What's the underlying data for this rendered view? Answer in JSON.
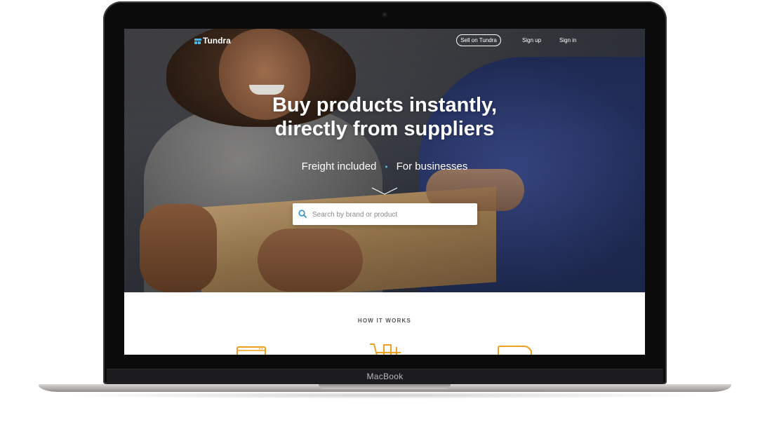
{
  "device": {
    "label": "MacBook"
  },
  "nav": {
    "logo": "Tundra",
    "sell_button": "Sell on Tundra",
    "signup": "Sign up",
    "signin": "Sign in"
  },
  "hero": {
    "headline_line1": "Buy products instantly,",
    "headline_line2": "directly from suppliers",
    "tagline_left": "Freight included",
    "tagline_separator": "•",
    "tagline_right": "For businesses"
  },
  "search": {
    "placeholder": "Search by brand or product",
    "value": ""
  },
  "how_it_works": {
    "title": "HOW IT WORKS"
  },
  "colors": {
    "accent": "#4ab3e6",
    "icon_orange": "#f0a020"
  },
  "icons": [
    "search-icon",
    "chevron-down-icon",
    "browser-icon",
    "dolly-icon",
    "truck-icon"
  ]
}
